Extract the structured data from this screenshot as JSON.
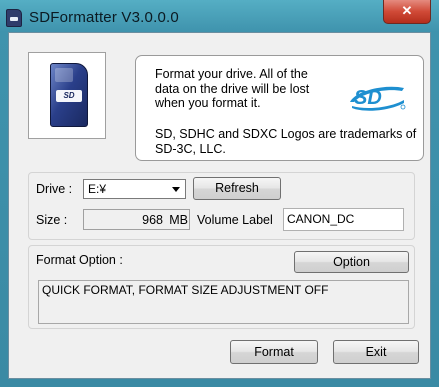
{
  "window": {
    "title": "SDFormatter V3.0.0.0",
    "close_glyph": "✕"
  },
  "info": {
    "message": "Format your drive. All of the data on the drive will be lost when you format it.",
    "trademark": "SD, SDHC and SDXC Logos are trademarks of SD-3C, LLC.",
    "logo_text": "SD"
  },
  "drive": {
    "label": "Drive :",
    "selected": "E:¥",
    "refresh_label": "Refresh"
  },
  "size": {
    "label": "Size  :",
    "value": "968",
    "unit": "MB"
  },
  "volume": {
    "label": "Volume Label",
    "value": "CANON_DC"
  },
  "format_option": {
    "label": "Format Option :",
    "option_button": "Option",
    "description": "QUICK FORMAT, FORMAT SIZE ADJUSTMENT OFF"
  },
  "actions": {
    "format_label": "Format",
    "exit_label": "Exit"
  },
  "icons": {
    "app": "sd-card-icon",
    "card": "sd-card-image",
    "logo": "sd-logo-icon"
  },
  "colors": {
    "title_bar": "#4aa0bb",
    "close_button": "#d04a37",
    "logo_blue": "#1e8fd0"
  }
}
